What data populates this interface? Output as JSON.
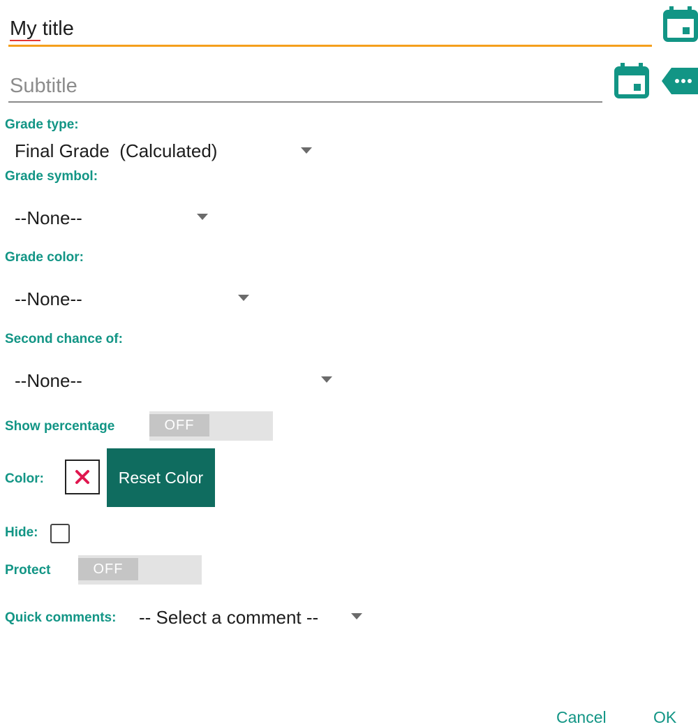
{
  "title": {
    "value": "My title"
  },
  "subtitle": {
    "placeholder": "Subtitle"
  },
  "grade_type": {
    "label": "Grade type:",
    "selected": "Final Grade  (Calculated)"
  },
  "grade_symbol": {
    "label": "Grade symbol:",
    "selected": "--None--"
  },
  "grade_color": {
    "label": "Grade color:",
    "selected": "--None--"
  },
  "second_chance": {
    "label": "Second chance of:",
    "selected": "--None--"
  },
  "show_percentage": {
    "label": "Show percentage",
    "state": "OFF"
  },
  "color": {
    "label": "Color:",
    "reset_label": "Reset Color"
  },
  "hide": {
    "label": "Hide:",
    "checked": false
  },
  "protect": {
    "label": "Protect",
    "state": "OFF"
  },
  "quick_comments": {
    "label": "Quick comments:",
    "selected": "-- Select a comment --"
  },
  "dialog": {
    "cancel_label": "Cancel",
    "ok_label": "OK"
  },
  "colors": {
    "accent": "#129585",
    "button_dark": "#0f6c5f",
    "focus_underline": "#f59f1c",
    "remove_x": "#e0174f"
  },
  "icons": [
    "calendar-icon",
    "calendar-icon",
    "tag-more-icon",
    "remove-color-icon",
    "dropdown-arrow-icon"
  ]
}
